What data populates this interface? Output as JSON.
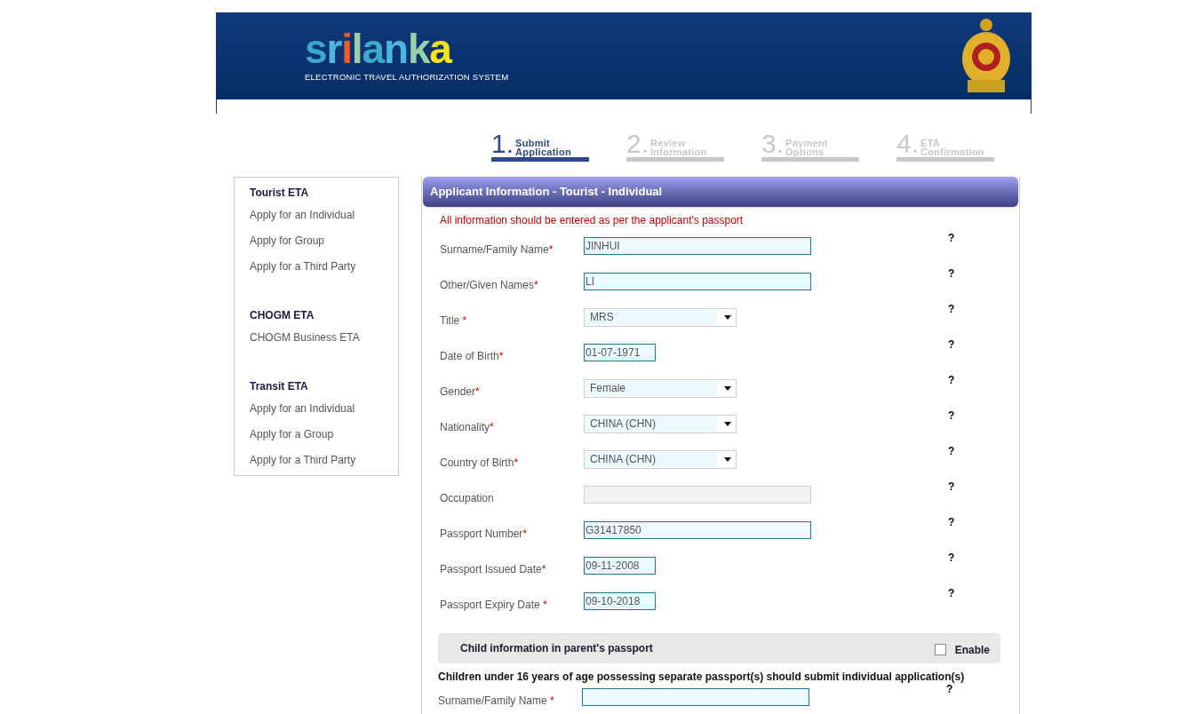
{
  "header": {
    "logo": "srilanka",
    "subtitle": "ELECTRONIC TRAVEL AUTHORIZATION SYSTEM"
  },
  "steps": [
    {
      "number": "1.",
      "label_top": "Submit",
      "label_bottom": "Application",
      "selected": true
    },
    {
      "number": "2.",
      "label_top": "Review",
      "label_bottom": "Information",
      "selected": false
    },
    {
      "number": "3.",
      "label_top": "Payment",
      "label_bottom": "Options",
      "selected": false
    },
    {
      "number": "4.",
      "label_top": "ETA",
      "label_bottom": "Confirmation",
      "selected": false
    }
  ],
  "sidebar": [
    {
      "title": "Tourist ETA",
      "items": [
        "Apply for an Individual",
        "Apply for Group",
        "Apply for a Third Party"
      ]
    },
    {
      "title": "CHOGM ETA",
      "items": [
        "CHOGM Business ETA"
      ]
    },
    {
      "title": "Transit ETA",
      "items": [
        "Apply for an Individual",
        "Apply for a Group",
        "Apply for a Third Party"
      ]
    }
  ],
  "panel": {
    "title": "Applicant Information - Tourist - Individual",
    "notice": "All information should be entered as per the applicant's passport",
    "fields": [
      {
        "label": "Surname/Family Name",
        "mark": "*",
        "kind": "text",
        "value": "JINHUI",
        "help": "?"
      },
      {
        "label": "Other/Given Names",
        "mark": "*",
        "kind": "text",
        "value": "LI",
        "help": "?"
      },
      {
        "label": "Title",
        "mark": " *",
        "kind": "select",
        "value": "MRS",
        "help": "?"
      },
      {
        "label": "Date of Birth",
        "mark": "*",
        "kind": "date",
        "value": "01-07-1971",
        "help": "?"
      },
      {
        "label": "Gender",
        "mark": "*",
        "kind": "select",
        "value": "Female",
        "help": "?"
      },
      {
        "label": "Nationality",
        "mark": "*",
        "kind": "select",
        "value": "CHINA (CHN)",
        "help": "?"
      },
      {
        "label": "Country of Birth",
        "mark": "*",
        "kind": "select",
        "value": "CHINA (CHN)",
        "help": "?"
      },
      {
        "label": "Occupation",
        "kind": "disabled",
        "help": "?"
      },
      {
        "label": "Passport Number",
        "mark": "*",
        "kind": "text",
        "value": "G31417850",
        "help": "?"
      },
      {
        "label": "Passport Issued Date",
        "mark": "*",
        "kind": "date",
        "value": "09-11-2008",
        "help": "?"
      },
      {
        "label": "Passport Expiry Date",
        "mark": " *",
        "kind": "date",
        "value": "09-10-2018",
        "help": "?"
      }
    ],
    "child_section": {
      "title": "Child information in parent's passport",
      "enable_label": "Enable",
      "checked": false
    },
    "child_note": "Children under 16 years of age possessing separate passport(s) should submit individual application(s)",
    "child_fields": [
      {
        "label": "Surname/Family Name",
        "mark": " *",
        "kind": "text",
        "help": "?"
      }
    ]
  }
}
